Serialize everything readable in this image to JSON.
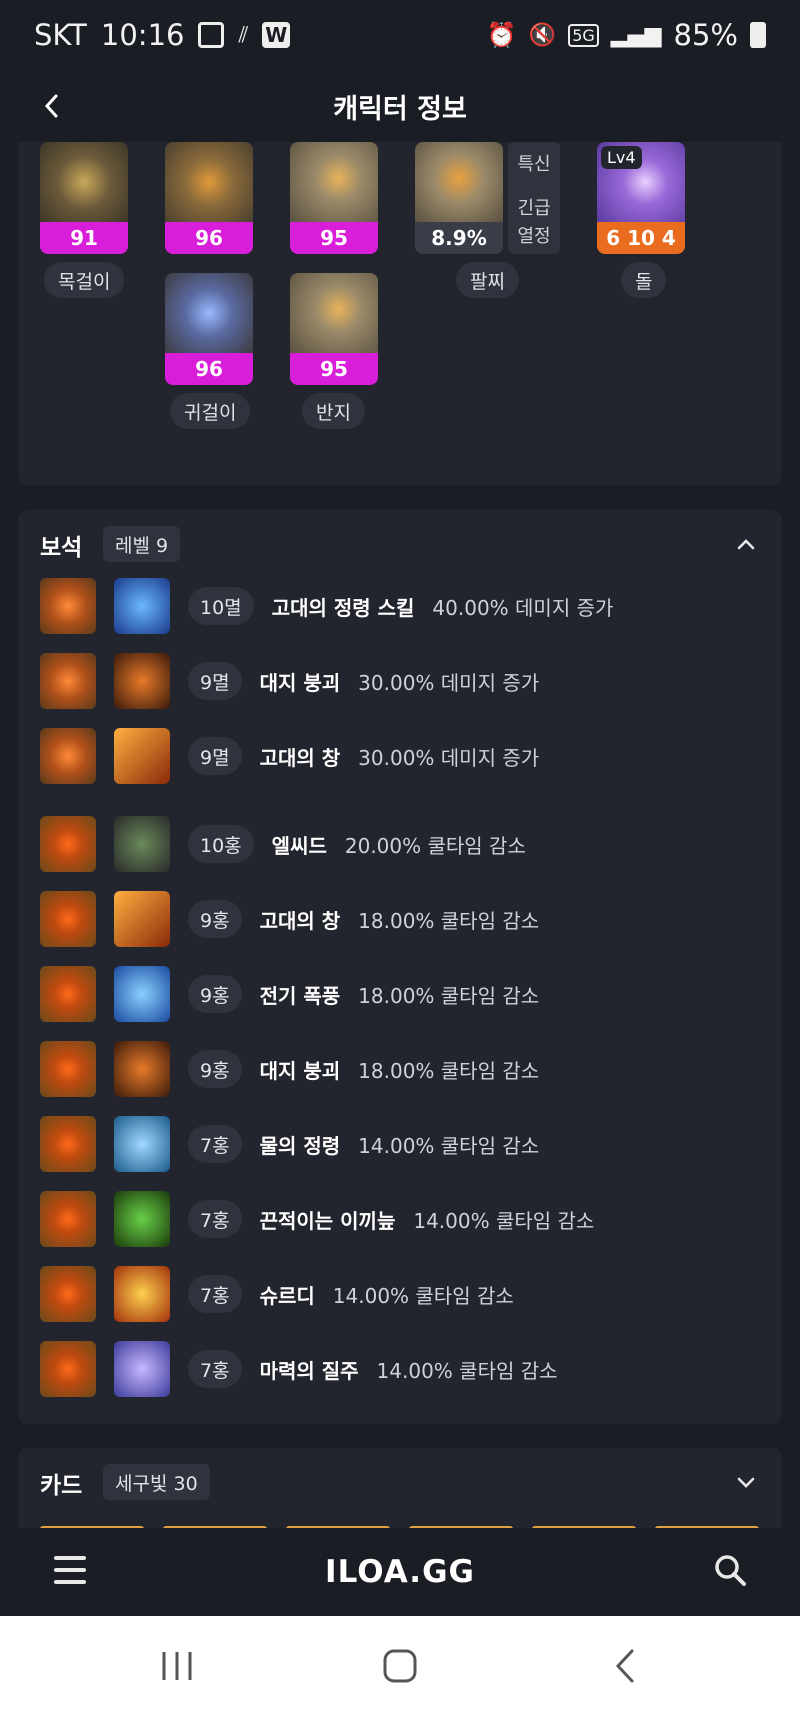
{
  "status_bar": {
    "carrier": "SKT",
    "time": "10:16",
    "network": "5G",
    "battery": "85%"
  },
  "header": {
    "title": "캐릭터 정보"
  },
  "equipment": {
    "items": [
      {
        "label": "목걸이",
        "value": "91"
      },
      {
        "label": "",
        "value": "96"
      },
      {
        "label": "",
        "value": "95"
      },
      {
        "label": "팔찌",
        "value": "8.9%",
        "stats": [
          "특신",
          "긴급",
          "열정"
        ]
      },
      {
        "label": "돌",
        "value": "6 10 4",
        "level": "Lv4"
      },
      {
        "label": "귀걸이",
        "value": "96"
      },
      {
        "label": "반지",
        "value": "95"
      }
    ]
  },
  "gems": {
    "title": "보석",
    "level_badge": "레벨 9",
    "rows": [
      {
        "level": "10멸",
        "skill": "고대의 정령 스킬",
        "effect": "40.00% 데미지 증가"
      },
      {
        "level": "9멸",
        "skill": "대지 붕괴",
        "effect": "30.00% 데미지 증가"
      },
      {
        "level": "9멸",
        "skill": "고대의 창",
        "effect": "30.00% 데미지 증가"
      },
      {
        "level": "10홍",
        "skill": "엘씨드",
        "effect": "20.00% 쿨타임 감소"
      },
      {
        "level": "9홍",
        "skill": "고대의 창",
        "effect": "18.00% 쿨타임 감소"
      },
      {
        "level": "9홍",
        "skill": "전기 폭풍",
        "effect": "18.00% 쿨타임 감소"
      },
      {
        "level": "9홍",
        "skill": "대지 붕괴",
        "effect": "18.00% 쿨타임 감소"
      },
      {
        "level": "7홍",
        "skill": "물의 정령",
        "effect": "14.00% 쿨타임 감소"
      },
      {
        "level": "7홍",
        "skill": "끈적이는 이끼늪",
        "effect": "14.00% 쿨타임 감소"
      },
      {
        "level": "7홍",
        "skill": "슈르디",
        "effect": "14.00% 쿨타임 감소"
      },
      {
        "level": "7홍",
        "skill": "마력의 질주",
        "effect": "14.00% 쿨타임 감소"
      }
    ]
  },
  "cards": {
    "title": "카드",
    "set_badge": "세구빛 30"
  },
  "bottom_bar": {
    "logo": "ILOA.GG"
  },
  "colors": {
    "background": "#1b1d24",
    "card": "#23252e",
    "quality_magenta": "#d81ed8",
    "stone_orange": "#ea6d1f"
  }
}
